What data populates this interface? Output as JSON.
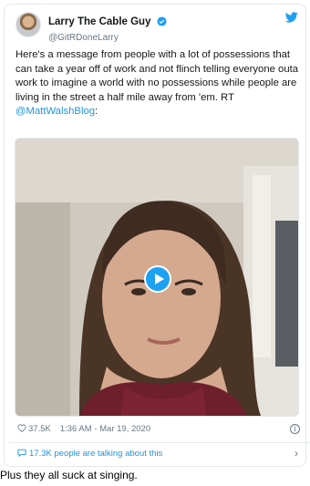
{
  "tweet": {
    "display_name": "Larry The Cable Guy",
    "handle": "@GitRDoneLarry",
    "text_before": "Here's a message from people with a lot of possessions that can take a year off of work and not flinch telling everyone outa work to imagine a world with no possessions while people are living in the street a half mile away from 'em. RT ",
    "mention": "@MattWalshBlog",
    "text_after": ":",
    "likes": "37.5K",
    "timestamp": "1:36 AM - Mar 19, 2020",
    "talking": "17.3K people are talking about this",
    "info_glyph": "i",
    "chevron_glyph": "›"
  },
  "caption": "Plus they all suck at singing.",
  "colors": {
    "accent": "#1da1f2",
    "link": "#1b95e0",
    "muted": "#657786",
    "border": "#e1e8ed"
  },
  "icons": [
    "verified-badge-icon",
    "twitter-bird-icon",
    "play-icon",
    "heart-icon",
    "info-icon",
    "speech-bubble-icon",
    "chevron-right-icon"
  ]
}
